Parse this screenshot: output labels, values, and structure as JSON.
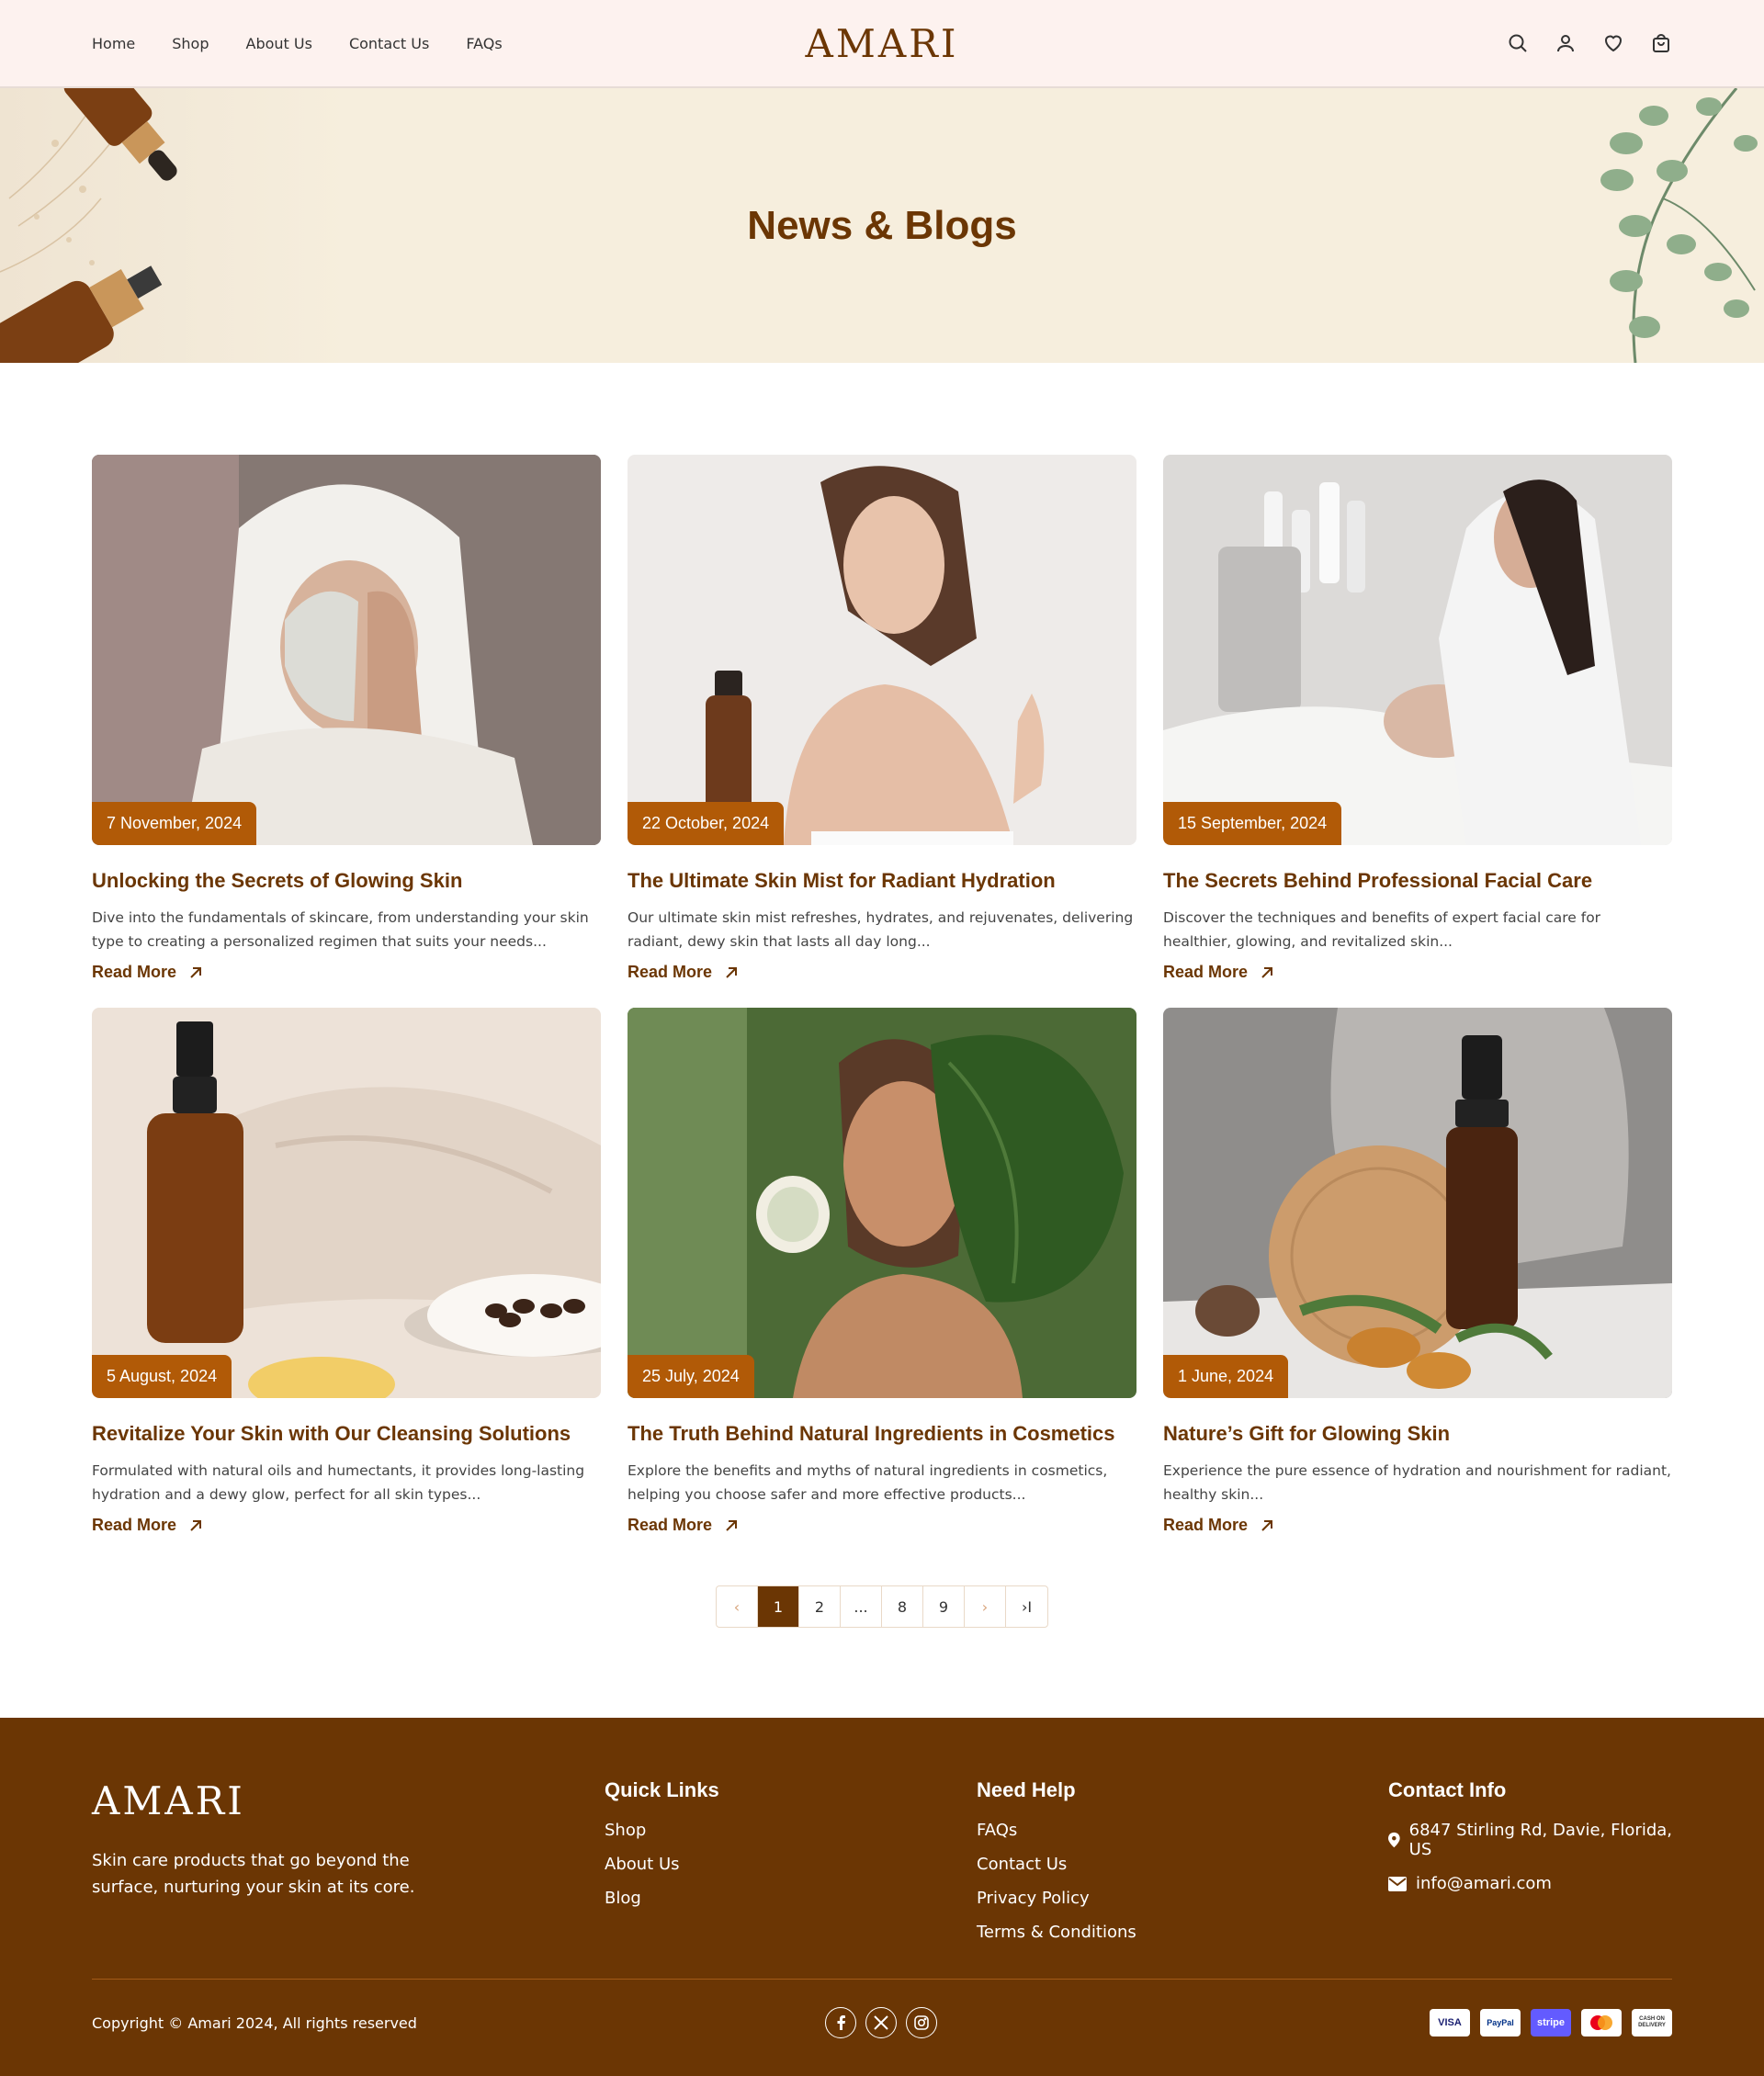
{
  "header": {
    "nav": [
      "Home",
      "Shop",
      "About Us",
      "Contact Us",
      "FAQs"
    ],
    "logo": "AMARI",
    "icons": [
      "search-icon",
      "user-icon",
      "heart-icon",
      "bag-icon"
    ]
  },
  "hero": {
    "title": "News & Blogs"
  },
  "posts": [
    {
      "date": "7 November, 2024",
      "title": "Unlocking the Secrets of Glowing Skin",
      "desc": "Dive into the fundamentals of skincare, from understanding your skin type to creating a personalized regimen that suits your needs...",
      "read_more": "Read More"
    },
    {
      "date": "22 October, 2024",
      "title": "The Ultimate Skin Mist for Radiant Hydration",
      "desc": "Our ultimate skin mist refreshes, hydrates, and rejuvenates, delivering radiant, dewy skin that lasts all day long...",
      "read_more": "Read More"
    },
    {
      "date": "15 September, 2024",
      "title": "The Secrets Behind Professional Facial Care",
      "desc": "Discover the techniques and benefits of expert facial care for healthier, glowing, and revitalized skin...",
      "read_more": "Read More"
    },
    {
      "date": "5 August, 2024",
      "title": "Revitalize Your Skin with Our Cleansing Solutions",
      "desc": "Formulated with natural oils and humectants, it provides long-lasting hydration and a dewy glow, perfect for all skin types...",
      "read_more": "Read More"
    },
    {
      "date": "25 July, 2024",
      "title": "The Truth Behind Natural Ingredients in Cosmetics",
      "desc": "Explore the benefits and myths of natural ingredients in cosmetics, helping you choose safer and more effective products...",
      "read_more": "Read More"
    },
    {
      "date": "1 June, 2024",
      "title": "Nature’s Gift for Glowing Skin",
      "desc": "Experience the pure essence of hydration and nourishment for radiant, healthy skin...",
      "read_more": "Read More"
    }
  ],
  "pagination": {
    "prev": "‹",
    "pages": [
      "1",
      "2",
      "...",
      "8",
      "9"
    ],
    "active": "1",
    "next": "›",
    "last": "›I"
  },
  "footer": {
    "logo": "AMARI",
    "tagline": "Skin care products that go beyond the surface, nurturing your skin at its core.",
    "quick_links": {
      "title": "Quick Links",
      "items": [
        "Shop",
        "About Us",
        "Blog"
      ]
    },
    "need_help": {
      "title": "Need Help",
      "items": [
        "FAQs",
        "Contact Us",
        "Privacy Policy",
        "Terms & Conditions"
      ]
    },
    "contact": {
      "title": "Contact Info",
      "address": "6847 Stirling Rd, Davie, Florida, US",
      "email": "info@amari.com"
    },
    "copyright": "Copyright © Amari 2024, All rights reserved",
    "socials": [
      "facebook-icon",
      "x-icon",
      "instagram-icon"
    ],
    "payments": [
      "VISA",
      "PayPal",
      "stripe",
      "mastercard",
      "CASH ON DELIVERY"
    ]
  },
  "colors": {
    "brand": "#6b3604",
    "accent": "#b15a07",
    "header_bg": "#fdf2ef",
    "hero_bg": "#f6eedd"
  }
}
